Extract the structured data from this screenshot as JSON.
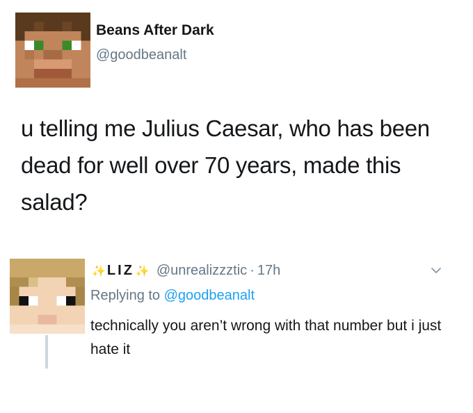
{
  "main_tweet": {
    "display_name": "Beans After Dark",
    "handle": "@goodbeanalt",
    "text": "u telling me Julius Caesar, who has been dead for well over 70 years, made this salad?"
  },
  "reply": {
    "sparkle_left": "✨",
    "display_name": "LIZ",
    "sparkle_right": "✨",
    "handle": "@unrealizzztic",
    "separator": "·",
    "time": "17h",
    "replying_prefix": "Replying to",
    "replying_mention": "@goodbeanalt",
    "text": "technically you aren’t wrong with that number but i just hate it"
  },
  "icons": {
    "main_avatar": "minecraft-skin-avatar",
    "reply_avatar": "minecraft-skin-avatar",
    "chevron": "chevron-down-icon"
  },
  "colors": {
    "text": "#14171a",
    "secondary": "#657786",
    "link": "#1da1f2",
    "sparkle": "#f4c542"
  }
}
